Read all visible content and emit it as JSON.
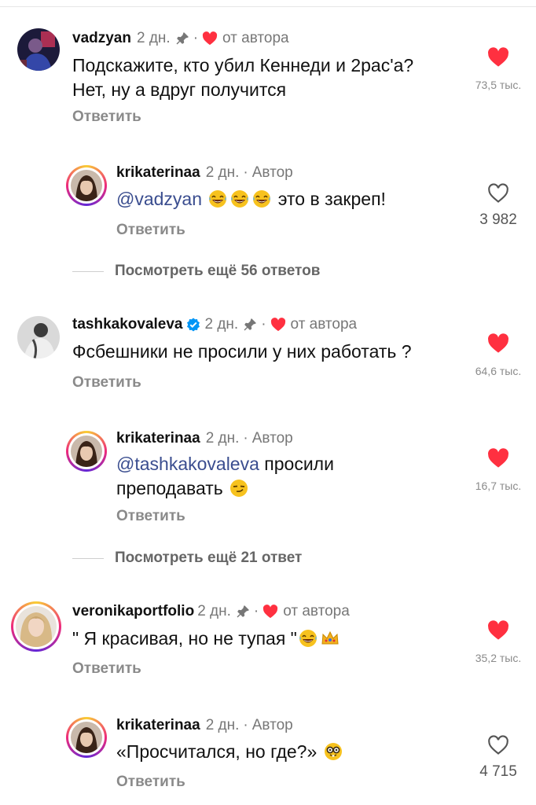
{
  "comments": [
    {
      "user": "vadzyan",
      "time": "2 дн.",
      "author_mark": "от автора",
      "text1": "Подскажите, кто убил Кеннеди и 2рас'а?",
      "text2": "Нет, ну а вдруг получится",
      "reply": "Ответить",
      "likes": "73,5 тыс."
    },
    {
      "user": "krikaterinaa",
      "time": "2 дн.",
      "author_mark": "Автор",
      "mention": "@vadzyan",
      "text1": "это в закреп!",
      "reply": "Ответить",
      "likes": "3 982"
    },
    {
      "user": "tashkakovaleva",
      "time": "2 дн.",
      "author_mark": "от автора",
      "text1": "Фсбешники не просили у них работать ?",
      "reply": "Ответить",
      "likes": "64,6 тыс."
    },
    {
      "user": "krikaterinaa",
      "time": "2 дн.",
      "author_mark": "Автор",
      "mention": "@tashkakovaleva",
      "text1": "просили",
      "text2": "преподавать",
      "reply": "Ответить",
      "likes": "16,7 тыс."
    },
    {
      "user": "veronikaportfolio",
      "time": "2 дн.",
      "author_mark": "от автора",
      "text1": "\" Я красивая, но не тупая \"",
      "reply": "Ответить",
      "likes": "35,2 тыс."
    },
    {
      "user": "krikaterinaa",
      "time": "2 дн.",
      "author_mark": "Автор",
      "text1": "«Просчитался, но где?»",
      "reply": "Ответить",
      "likes": "4 715"
    }
  ],
  "more_replies": [
    "Посмотреть ещё 56 ответов",
    "Посмотреть ещё 21 ответ"
  ],
  "separator": "·",
  "icons": {
    "heart_filled": "heart-filled-icon",
    "heart_outline": "heart-outline-icon",
    "pin": "pin-icon",
    "verified": "verified-badge-icon",
    "emoji_laugh": "tears-of-joy-emoji",
    "emoji_smirk": "smirk-emoji",
    "emoji_crown": "crown-emoji",
    "emoji_nerd": "nerd-face-emoji"
  },
  "colors": {
    "heart_red": "#ff3040",
    "mention": "#3a4d8f",
    "verified": "#0095f6"
  }
}
